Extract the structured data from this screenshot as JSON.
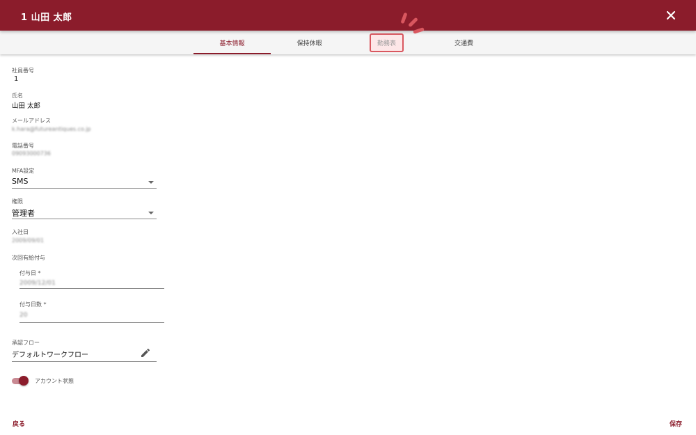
{
  "header": {
    "title": "1  山田 太郎"
  },
  "tabs": [
    {
      "label": "基本情報"
    },
    {
      "label": "保持休暇"
    },
    {
      "label": "勤務表"
    },
    {
      "label": "交通費"
    }
  ],
  "form": {
    "employee_no": {
      "label": "社員番号",
      "value": "1"
    },
    "name": {
      "label": "氏名",
      "value": "山田 太郎"
    },
    "email": {
      "label": "メールアドレス",
      "value": "k.hara@futureantiques.co.jp"
    },
    "phone": {
      "label": "電話番号",
      "value": "09093000736"
    },
    "mfa": {
      "label": "MFA設定",
      "value": "SMS"
    },
    "role": {
      "label": "権限",
      "value": "管理者"
    },
    "join_date": {
      "label": "入社日",
      "value": "2009/09/01"
    },
    "next_leave": {
      "label": "次回有給付与",
      "grant_date": {
        "label": "付与日 *",
        "value": "2009/12/01"
      },
      "grant_days": {
        "label": "付与日数 *",
        "value": "20"
      }
    },
    "approval_flow": {
      "label": "承認フロー",
      "value": "デフォルトワークフロー"
    },
    "account_status": {
      "label": "アカウント状態",
      "enabled": true
    }
  },
  "footer": {
    "back_label": "戻る",
    "save_label": "保存"
  },
  "colors": {
    "brand": "#8b1c2b",
    "highlight": "#d9575f"
  },
  "icons": {
    "close": "close-icon",
    "edit": "pencil-icon",
    "dropdown": "caret-down-icon"
  }
}
